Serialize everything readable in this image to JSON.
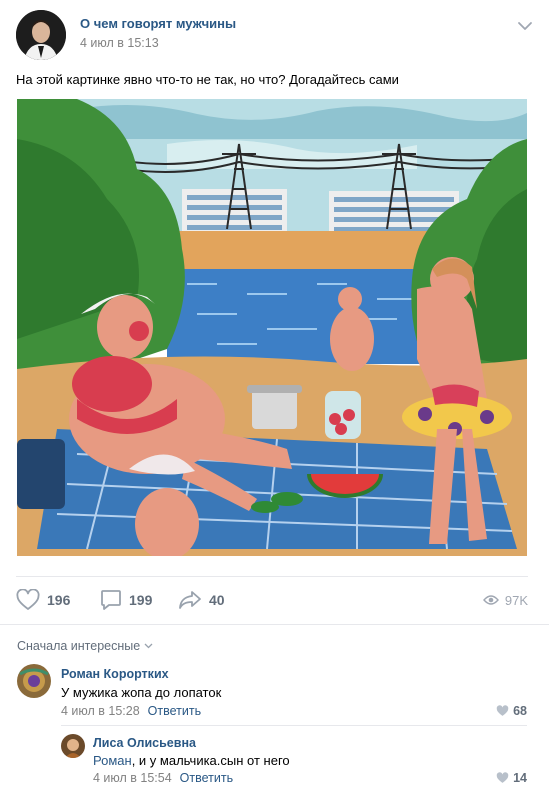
{
  "post": {
    "group_name": "О чем говорят мужчины",
    "date": "4 июл в 15:13",
    "text": "На этой картинке явно что-то не так, но что? Догадайтесь сами",
    "likes": "196",
    "comments": "199",
    "shares": "40",
    "views": "97K"
  },
  "comments_section": {
    "sort_label": "Сначала интересные",
    "items": [
      {
        "author": "Роман Корортких",
        "text": "У мужика жопа до лопаток",
        "date": "4 июл в 15:28",
        "reply_label": "Ответить",
        "likes": "68"
      },
      {
        "author": "Лиса Олисьевна",
        "mention": "Роман",
        "text": ", и у мальчика.сын от него",
        "date": "4 июл в 15:54",
        "reply_label": "Ответить",
        "likes": "14"
      }
    ]
  },
  "colors": {
    "link": "#2a5885",
    "meta": "#828282",
    "icon": "#99a2ad",
    "divider": "#e7e8ec"
  }
}
